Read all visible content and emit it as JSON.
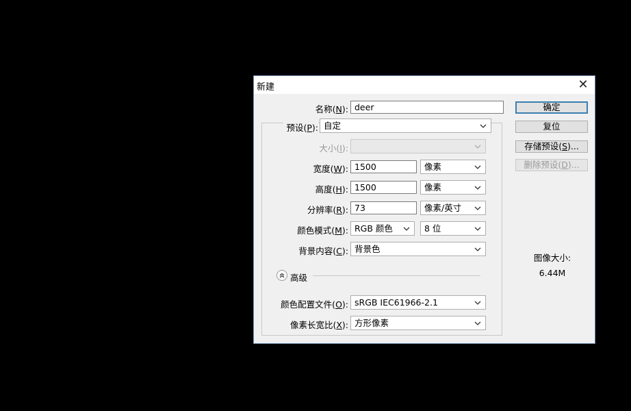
{
  "dialog": {
    "title": "新建",
    "close_icon": "close-icon"
  },
  "fields": {
    "name": {
      "label_pre": "名称(",
      "mnemonic": "N",
      "label_post": "):",
      "value": "deer"
    },
    "preset": {
      "label_pre": "预设(",
      "mnemonic": "P",
      "label_post": "):",
      "value": "自定"
    },
    "size": {
      "label_pre": "大小(",
      "mnemonic": "I",
      "label_post": "):",
      "value": ""
    },
    "width": {
      "label_pre": "宽度(",
      "mnemonic": "W",
      "label_post": "):",
      "value": "1500",
      "unit": "像素"
    },
    "height": {
      "label_pre": "高度(",
      "mnemonic": "H",
      "label_post": "):",
      "value": "1500",
      "unit": "像素"
    },
    "resolution": {
      "label_pre": "分辨率(",
      "mnemonic": "R",
      "label_post": "):",
      "value": "73",
      "unit": "像素/英寸"
    },
    "color_mode": {
      "label_pre": "颜色模式(",
      "mnemonic": "M",
      "label_post": "):",
      "value": "RGB 颜色",
      "bits": "8 位"
    },
    "background": {
      "label_pre": "背景内容(",
      "mnemonic": "C",
      "label_post": "):",
      "value": "背景色"
    },
    "advanced_label": "高级",
    "color_profile": {
      "label_pre": "颜色配置文件(",
      "mnemonic": "O",
      "label_post": "):",
      "value": "sRGB IEC61966-2.1"
    },
    "pixel_aspect": {
      "label_pre": "像素长宽比(",
      "mnemonic": "X",
      "label_post": "):",
      "value": "方形像素"
    }
  },
  "buttons": {
    "ok": "确定",
    "reset": "复位",
    "save_preset": {
      "pre": "存储预设(",
      "mnemonic": "S",
      "post": ")..."
    },
    "delete_preset": {
      "pre": "删除预设(",
      "mnemonic": "D",
      "post": ")..."
    }
  },
  "image_size": {
    "label": "图像大小:",
    "value": "6.44M"
  }
}
